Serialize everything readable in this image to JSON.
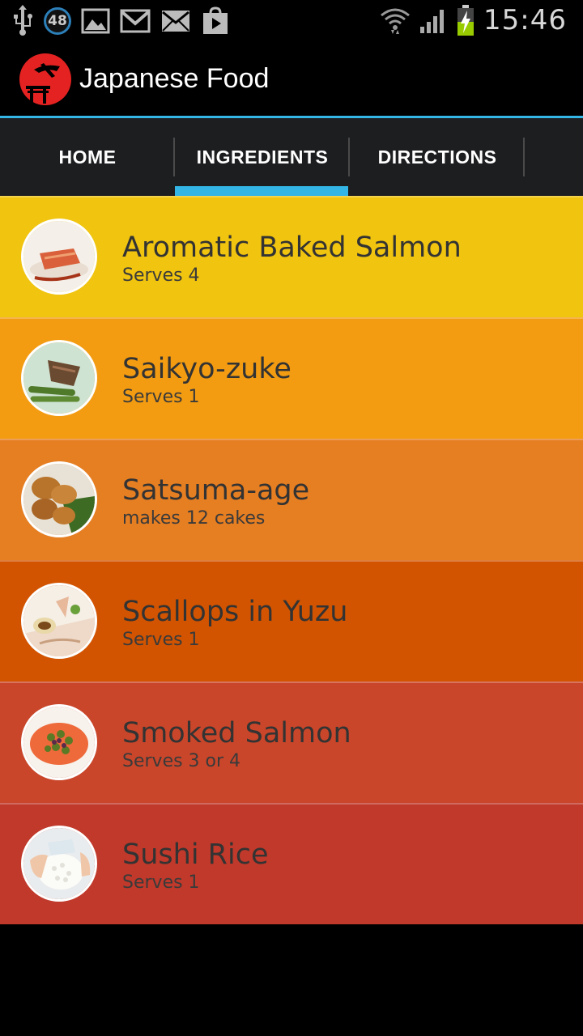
{
  "status_bar": {
    "time": "15:46",
    "notification_badge": "48",
    "icons": [
      "usb-icon",
      "badge-48-icon",
      "image-icon",
      "gmail-icon",
      "mail-icon",
      "play-store-icon",
      "wifi-icon",
      "signal-icon",
      "battery-charging-icon"
    ]
  },
  "action_bar": {
    "title": "Japanese Food",
    "logo": "japanese-food-logo-icon"
  },
  "tabs": [
    {
      "label": "HOME",
      "selected": false
    },
    {
      "label": "INGREDIENTS",
      "selected": true
    },
    {
      "label": "DIRECTIONS",
      "selected": false
    }
  ],
  "accent_color": "#33b5e5",
  "recipes": [
    {
      "title": "Aromatic Baked Salmon",
      "subtitle": "Serves 4",
      "color": "#f1c40f"
    },
    {
      "title": "Saikyo-zuke",
      "subtitle": "Serves 1",
      "color": "#f39c12"
    },
    {
      "title": "Satsuma-age",
      "subtitle": "makes 12 cakes",
      "color": "#e67e22"
    },
    {
      "title": "Scallops in Yuzu",
      "subtitle": "Serves 1",
      "color": "#d35400"
    },
    {
      "title": "Smoked Salmon",
      "subtitle": "Serves 3 or 4",
      "color": "#c9462a"
    },
    {
      "title": "Sushi Rice",
      "subtitle": "Serves 1",
      "color": "#c0392b"
    }
  ]
}
